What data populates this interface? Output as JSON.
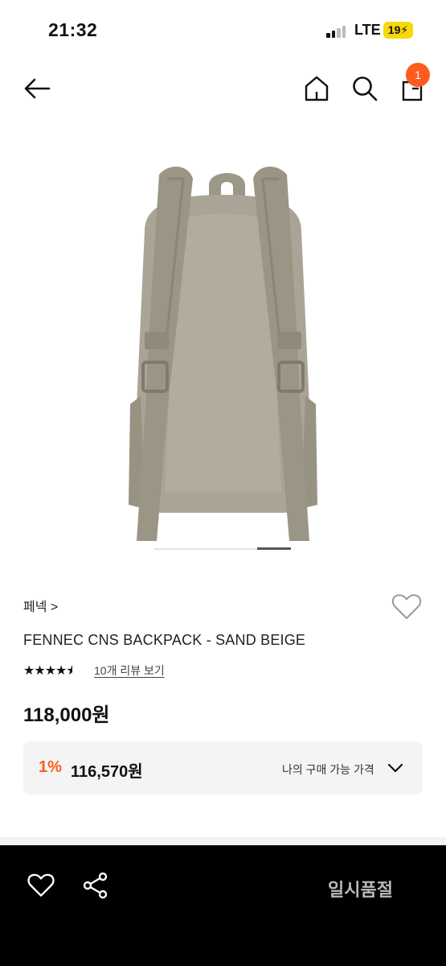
{
  "status_bar": {
    "time": "21:32",
    "network": "LTE",
    "battery": "19"
  },
  "nav": {
    "cart_count": "1",
    "icons": [
      "back-arrow-icon",
      "home-icon",
      "search-icon",
      "shopping-bag-icon"
    ]
  },
  "gallery": {
    "image": "backpack-sand-beige",
    "page_current": 4,
    "page_total": 4
  },
  "product": {
    "brand": "페넥 >",
    "name": "FENNEC CNS BACKPACK - SAND BEIGE",
    "rating": 4.5,
    "review_link": "10개 리뷰 보기",
    "price": "118,000원"
  },
  "discount_box": {
    "percent": "1%",
    "price": "116,570원",
    "label": "나의 구매 가능 가격"
  },
  "bottom_bar": {
    "sold_out": "일시품절"
  },
  "colors": {
    "accent": "#ff5a1f",
    "battery": "#f5d90a",
    "bottom_bar": "#000000",
    "backpack": "#a49f90"
  }
}
